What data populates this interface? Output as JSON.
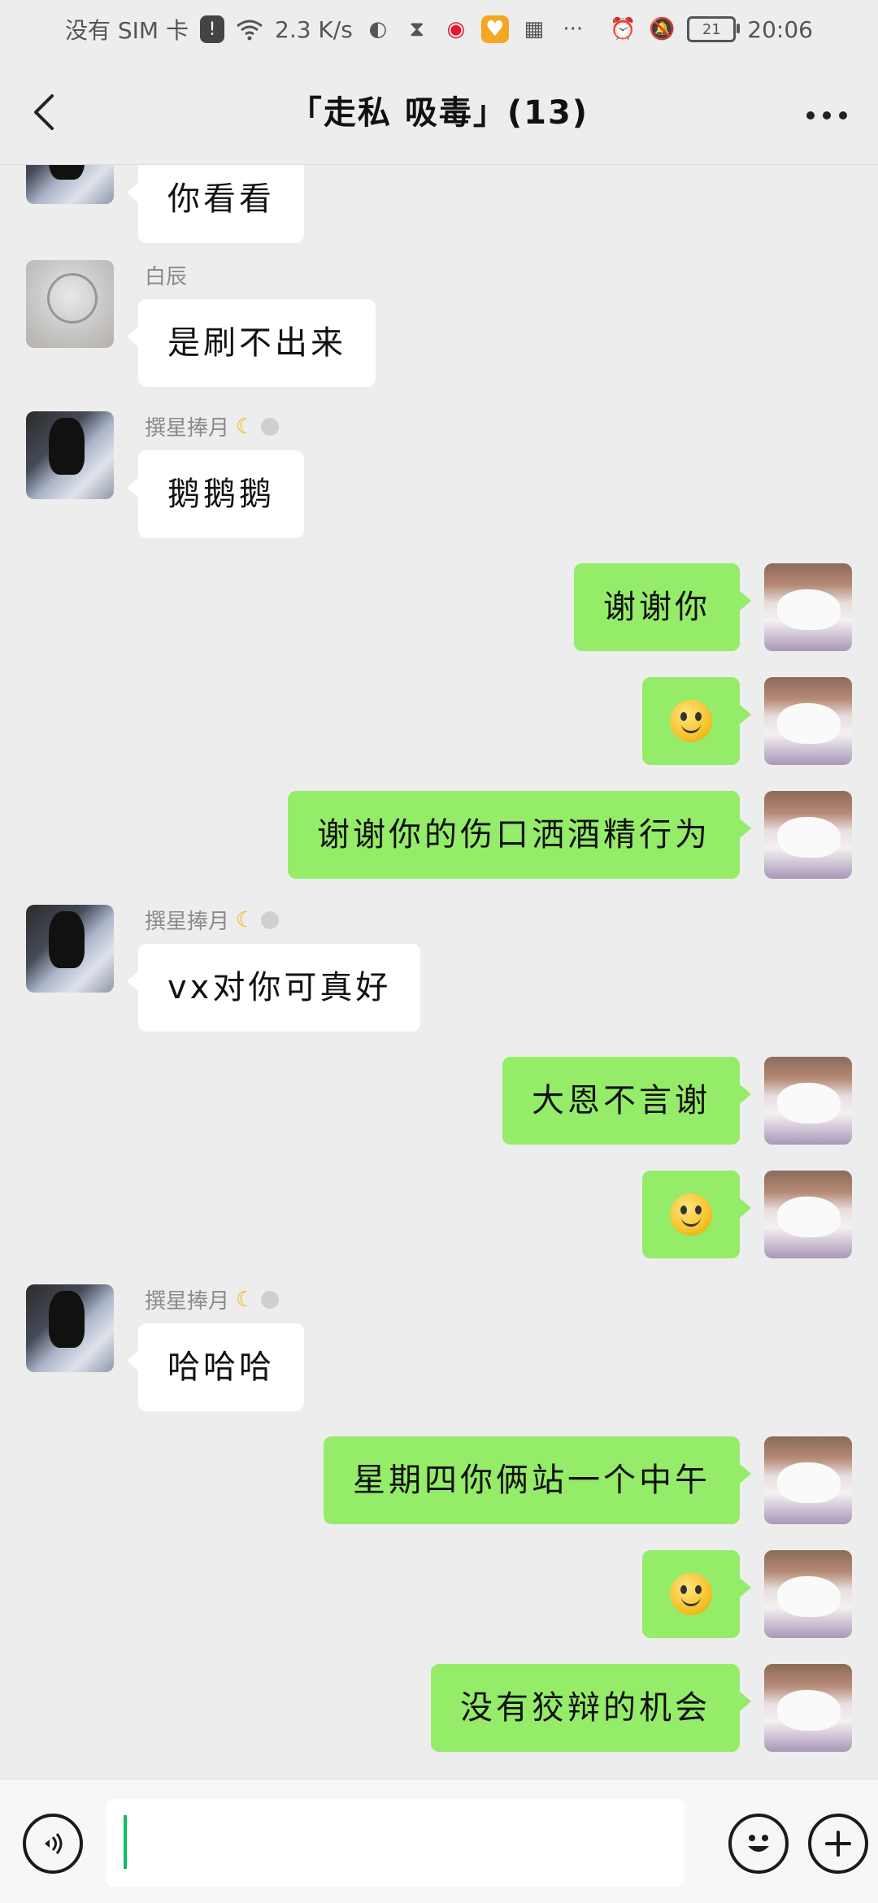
{
  "status_bar": {
    "carrier": "没有 SIM 卡",
    "speed": "2.3 K/s",
    "battery": "21",
    "time": "20:06",
    "icons": [
      "alert-icon",
      "wifi-icon",
      "browser-icon",
      "hourglass-icon",
      "weibo-icon",
      "heart-app-icon",
      "app-icon",
      "more-icon",
      "alarm-icon",
      "mute-icon",
      "battery-icon"
    ]
  },
  "header": {
    "title": "「走私 吸毒」(13)",
    "back_icon": "chevron-left-icon",
    "more_icon": "more-icon"
  },
  "messages": [
    {
      "side": "in",
      "sender": "",
      "avatar": "girl",
      "text": "你看看"
    },
    {
      "side": "in",
      "sender": "白辰",
      "avatar": "sketch",
      "text": "是刷不出来"
    },
    {
      "side": "in",
      "sender": "撰星捧月",
      "avatar": "girl",
      "text": "鹅鹅鹅"
    },
    {
      "side": "out",
      "avatar": "dog",
      "text": "谢谢你"
    },
    {
      "side": "out",
      "avatar": "dog",
      "emoji": "smiley-emoji"
    },
    {
      "side": "out",
      "avatar": "dog",
      "text": "谢谢你的伤口洒酒精行为"
    },
    {
      "side": "in",
      "sender": "撰星捧月",
      "avatar": "girl",
      "text": "vx对你可真好"
    },
    {
      "side": "out",
      "avatar": "dog",
      "text": "大恩不言谢"
    },
    {
      "side": "out",
      "avatar": "dog",
      "emoji": "smiley-emoji"
    },
    {
      "side": "in",
      "sender": "撰星捧月",
      "avatar": "girl",
      "text": "哈哈哈"
    },
    {
      "side": "out",
      "avatar": "dog",
      "text": "星期四你俩站一个中午"
    },
    {
      "side": "out",
      "avatar": "dog",
      "emoji": "smiley-emoji"
    },
    {
      "side": "out",
      "avatar": "dog",
      "text": "没有狡辩的机会"
    }
  ],
  "input_bar": {
    "value": "",
    "voice_icon": "voice-icon",
    "emoji_icon": "emoji-icon",
    "plus_icon": "plus-icon"
  },
  "colors": {
    "background": "#ededed",
    "outgoing_bubble": "#95ec69",
    "incoming_bubble": "#ffffff",
    "caret": "#07c160"
  }
}
